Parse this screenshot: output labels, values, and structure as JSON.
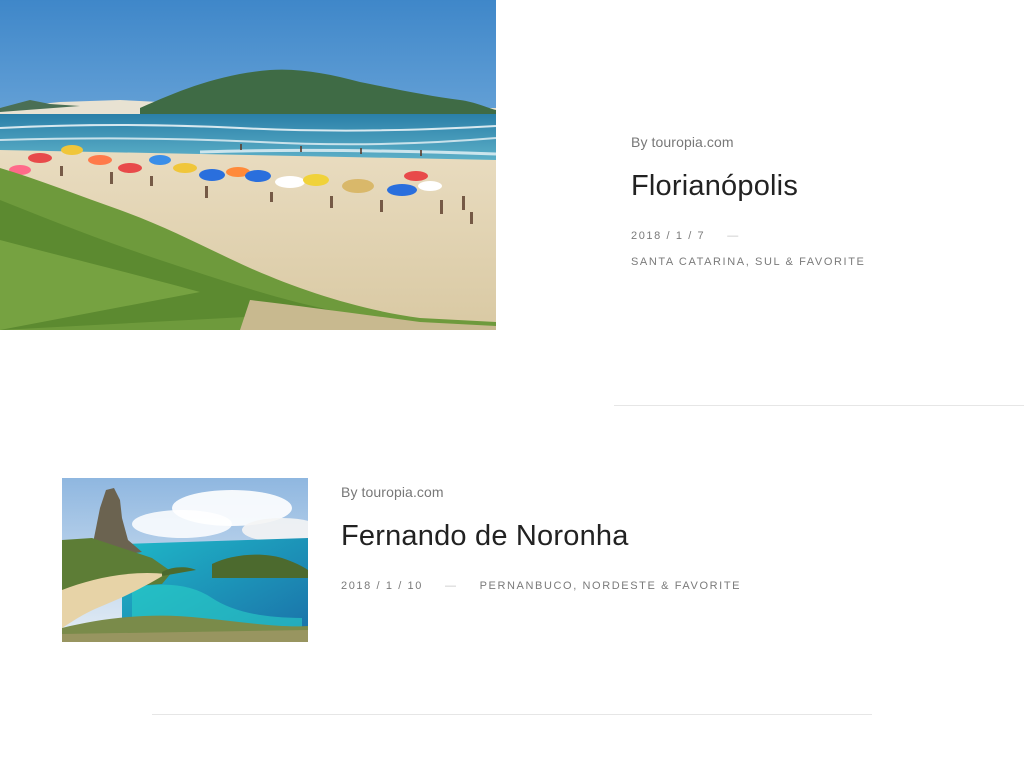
{
  "posts": [
    {
      "byline_prefix": "By",
      "source": "touropia.com",
      "title": "Florianópolis",
      "date": "2018 / 1 / 7",
      "dash": "—",
      "categories": [
        "Santa Catarina",
        "Sul",
        "Favorite"
      ],
      "cat_comma": ",",
      "cat_amp": "&",
      "image_alt": "Beach with umbrellas and green hill"
    },
    {
      "byline_prefix": "By",
      "source": "touropia.com",
      "title": "Fernando de Noronha",
      "date": "2018 / 1 / 10",
      "dash": "—",
      "categories": [
        "Pernanbuco",
        "Nordeste",
        "Favorite"
      ],
      "cat_comma": ",",
      "cat_amp": "&",
      "image_alt": "Turquoise bay with rocky peak"
    }
  ],
  "colors": {
    "text_dark": "#222222",
    "text_muted": "#777777",
    "divider": "#e6e6e6",
    "sea": "#2f8fb3",
    "sand": "#e6d9bd",
    "grass": "#6f9a3a"
  }
}
